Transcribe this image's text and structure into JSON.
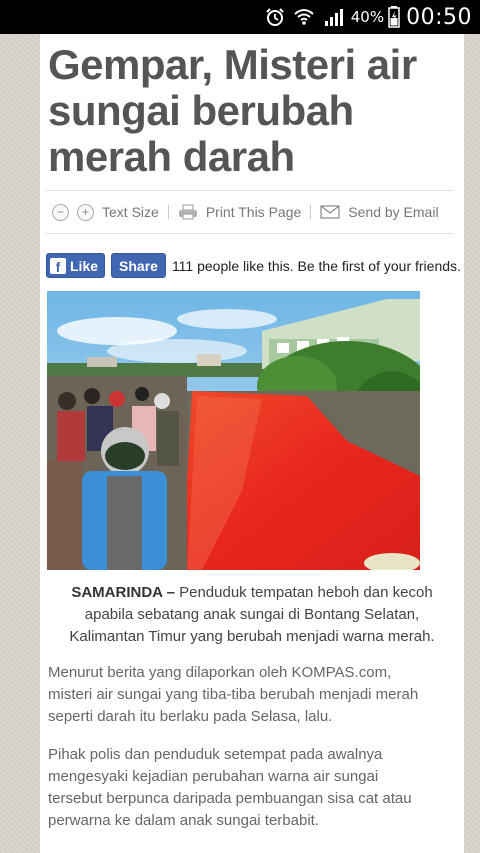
{
  "status_bar": {
    "battery_percent": "40%",
    "time": "00:50",
    "icons": [
      "alarm-icon",
      "wifi-icon",
      "signal-icon",
      "battery-icon"
    ]
  },
  "article": {
    "title_lines": [
      "Gempar, Misteri air",
      "sungai berubah",
      "merah darah"
    ],
    "tools": {
      "text_size_label": "Text Size",
      "decrease_symbol": "−",
      "increase_symbol": "+",
      "print_label": "Print This Page",
      "email_label": "Send by Email"
    },
    "social": {
      "like_label": "Like",
      "share_label": "Share",
      "likes_text": "111 people like this. Be the first of your friends."
    },
    "caption": {
      "location": "SAMARINDA –",
      "line1_rest": " Penduduk tempatan heboh dan kecoh",
      "line2": "apabila sebatang anak sungai di Bontang Selatan,",
      "line3": "Kalimantan Timur yang berubah menjadi warna merah."
    },
    "paragraphs": [
      {
        "lines": [
          "Menurut berita yang dilaporkan oleh KOMPAS.com,",
          "misteri air sungai yang tiba-tiba berubah menjadi merah",
          "seperti darah itu berlaku pada Selasa, lalu."
        ]
      },
      {
        "lines": [
          "Pihak polis dan penduduk setempat pada awalnya",
          "mengesyaki kejadian perubahan warna air sungai",
          "tersebut berpunca daripada pembuangan sisa cat atau",
          "perwarna ke dalam anak sungai terbabit."
        ]
      }
    ]
  },
  "colors": {
    "facebook_blue": "#4267b2",
    "river_red": "#e8261e",
    "title_gray": "#555555"
  }
}
